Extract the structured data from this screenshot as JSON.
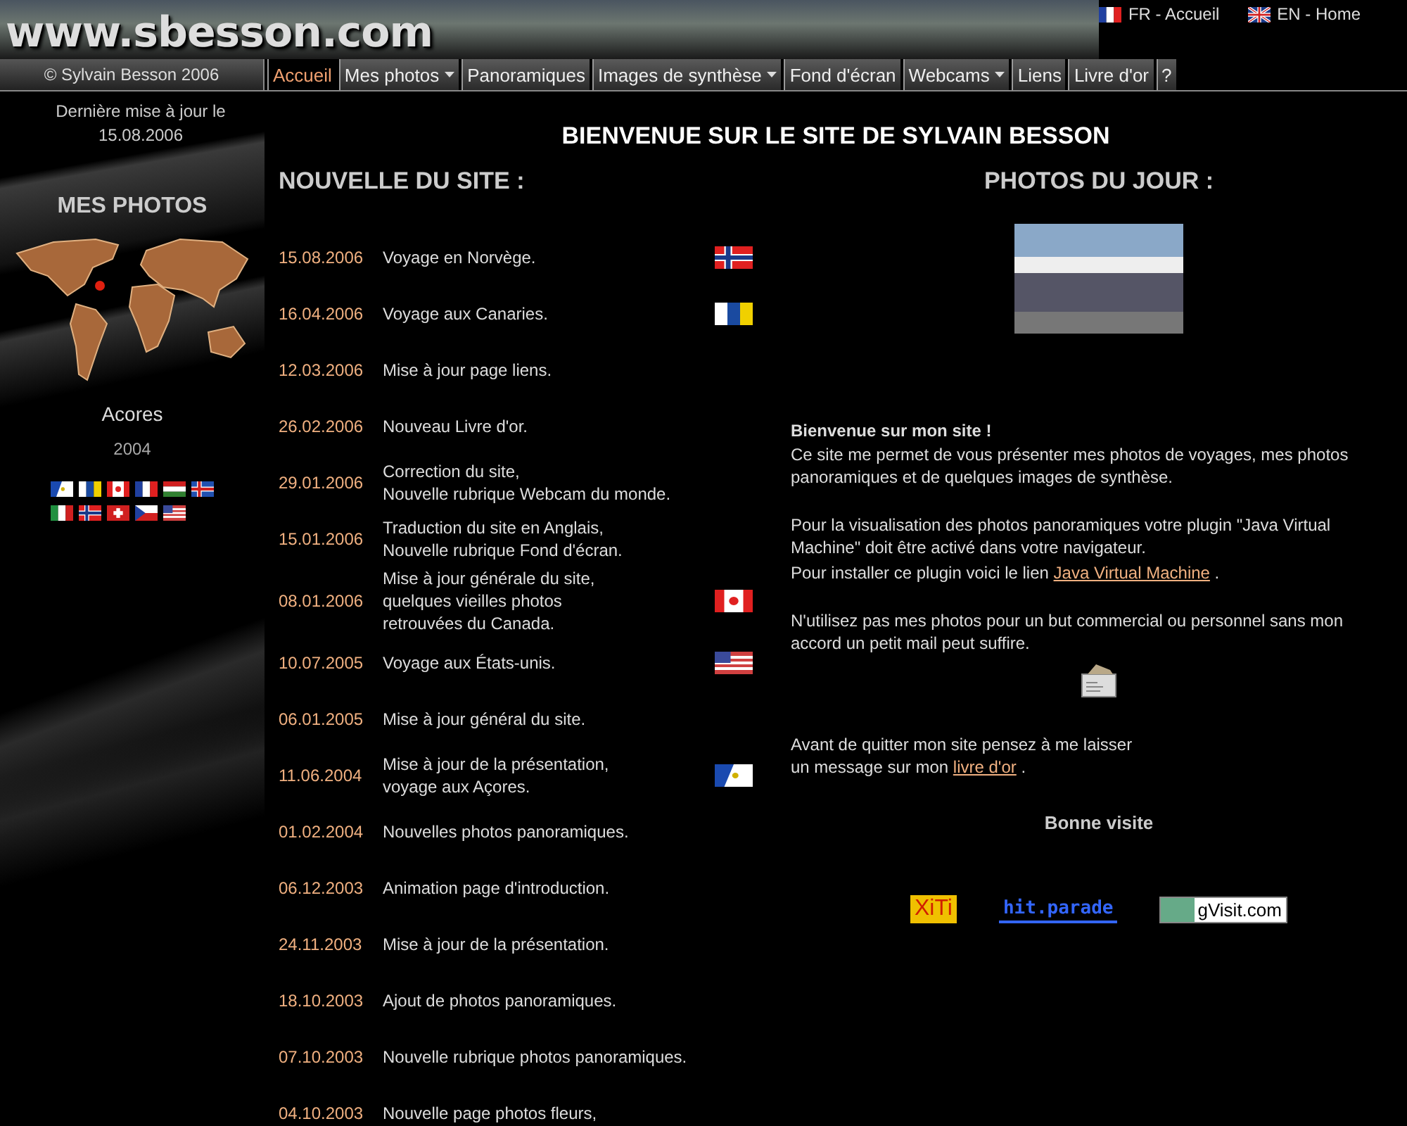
{
  "logo": {
    "text": "www.sbesson.com"
  },
  "languages": [
    {
      "label": "FR - Accueil",
      "kind": "france"
    },
    {
      "label": "EN - Home",
      "kind": "uk"
    }
  ],
  "copyright": "© Sylvain Besson 2006",
  "nav": [
    {
      "label": "Accueil",
      "selected": true,
      "dropdown": false
    },
    {
      "label": "Mes photos",
      "selected": false,
      "dropdown": true
    },
    {
      "label": "Panoramiques",
      "selected": false,
      "dropdown": false
    },
    {
      "label": "Images de synthèse",
      "selected": false,
      "dropdown": true
    },
    {
      "label": "Fond d'écran",
      "selected": false,
      "dropdown": false
    },
    {
      "label": "Webcams",
      "selected": false,
      "dropdown": true
    },
    {
      "label": "Liens",
      "selected": false,
      "dropdown": false
    },
    {
      "label": "Livre d'or",
      "selected": false,
      "dropdown": false
    },
    {
      "label": "?",
      "selected": false,
      "dropdown": false
    }
  ],
  "sidebar": {
    "updated": "Dernière mise à jour le 15.08.2006",
    "heading": "MES PHOTOS",
    "place": "Acores",
    "year": "2004",
    "flags": [
      {
        "kind": "azores"
      },
      {
        "kind": "canaries"
      },
      {
        "kind": "canada"
      },
      {
        "kind": "france"
      },
      {
        "kind": "hungary"
      },
      {
        "kind": "iceland"
      },
      {
        "kind": "italy"
      },
      {
        "kind": "norway"
      },
      {
        "kind": "swiss"
      },
      {
        "kind": "czech"
      },
      {
        "kind": "usa"
      }
    ]
  },
  "title": "BIENVENUE SUR LE SITE DE SYLVAIN BESSON",
  "news": {
    "heading": "NOUVELLE DU SITE :",
    "items": [
      {
        "date": "15.08.2006",
        "lines": [
          "Voyage en Norvège."
        ],
        "kind": "norway"
      },
      {
        "date": "16.04.2006",
        "lines": [
          "Voyage aux Canaries."
        ],
        "kind": "canaries"
      },
      {
        "date": "12.03.2006",
        "lines": [
          "Mise à jour page liens."
        ]
      },
      {
        "date": "26.02.2006",
        "lines": [
          "Nouveau Livre d'or."
        ]
      },
      {
        "date": "29.01.2006",
        "lines": [
          "Correction du site,",
          "Nouvelle rubrique Webcam du monde."
        ]
      },
      {
        "date": "15.01.2006",
        "lines": [
          "Traduction du site en Anglais,",
          "Nouvelle rubrique Fond d'écran."
        ]
      },
      {
        "date": "08.01.2006",
        "lines": [
          "Mise à jour générale du site,",
          "quelques vieilles photos",
          "retrouvées du Canada."
        ],
        "kind": "canada"
      },
      {
        "date": "10.07.2005",
        "lines": [
          "Voyage aux États-unis."
        ],
        "kind": "usa"
      },
      {
        "date": "06.01.2005",
        "lines": [
          "Mise à jour général du site."
        ]
      },
      {
        "date": "11.06.2004",
        "lines": [
          "Mise à jour de la présentation,",
          "voyage aux Açores."
        ],
        "kind": "azores"
      },
      {
        "date": "01.02.2004",
        "lines": [
          "Nouvelles photos panoramiques."
        ]
      },
      {
        "date": "06.12.2003",
        "lines": [
          "Animation page d'introduction."
        ]
      },
      {
        "date": "24.11.2003",
        "lines": [
          "Mise à jour de la présentation."
        ]
      },
      {
        "date": "18.10.2003",
        "lines": [
          "Ajout de photos  panoramiques."
        ]
      },
      {
        "date": "07.10.2003",
        "lines": [
          "Nouvelle rubrique photos panoramiques."
        ]
      },
      {
        "date": "04.10.2003",
        "lines": [
          "Nouvelle page photos fleurs,"
        ]
      }
    ]
  },
  "photos": {
    "heading": "PHOTOS DU JOUR :"
  },
  "welcome": {
    "heading": "Bienvenue sur mon site !",
    "intro": "Ce site me permet de vous présenter mes photos de voyages, mes photos panoramiques et de quelques images de synthèse.",
    "java": "Pour la visualisation des photos panoramiques votre plugin \"Java Virtual Machine\" doit être activé dans votre navigateur.",
    "install_before": "Pour installer ce plugin voici le lien",
    "install_link": "Java Virtual Machine",
    "install_after": ".",
    "usage": "N'utilisez pas mes photos pour un but commercial ou personnel sans mon accord un petit mail peut suffire.",
    "guest_before": "Avant de quitter mon site pensez à me laisser",
    "guest_line2": "un message sur mon",
    "guest_link": "livre d'or",
    "guest_after": ".",
    "farewell": "Bonne visite"
  },
  "counters": [
    {
      "label": "XiTi",
      "kind": "xiti"
    },
    {
      "label": "hit.parade",
      "kind": "hitparade"
    },
    {
      "label": "gVisit.com",
      "kind": "gvisit"
    }
  ]
}
